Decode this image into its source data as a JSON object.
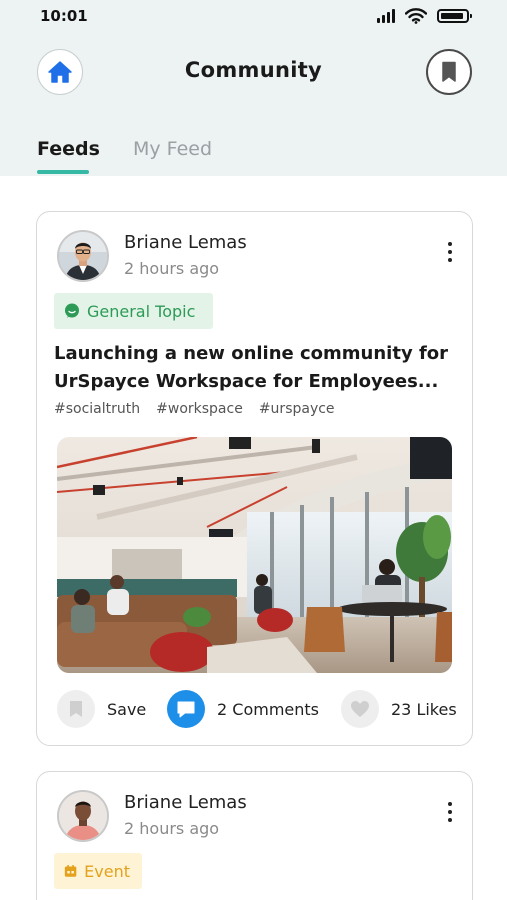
{
  "status_bar": {
    "time": "10:01"
  },
  "header": {
    "title": "Community",
    "home_icon": "home-icon",
    "bookmark_icon": "bookmark-icon"
  },
  "tabs": [
    {
      "label": "Feeds",
      "active": true
    },
    {
      "label": "My Feed",
      "active": false
    }
  ],
  "posts": [
    {
      "author": "Briane Lemas",
      "posted": "2 hours ago",
      "tag": {
        "label": "General Topic",
        "icon": "chat-bubble-icon",
        "color": "#2d9b57"
      },
      "title": "Launching a new online community for UrSpayce Workspace for Employees...",
      "hashtags": [
        "#socialtruth",
        "#workspace",
        "#urspayce"
      ],
      "image": "office-coworking-photo",
      "actions": {
        "save": "Save",
        "comments": "2 Comments",
        "likes": "23 Likes"
      }
    },
    {
      "author": "Briane Lemas",
      "posted": "2 hours ago",
      "tag": {
        "label": "Event",
        "icon": "calendar-icon",
        "color": "#e3a21c"
      }
    }
  ],
  "colors": {
    "accent": "#35b8a4",
    "comment_blue": "#1e8fe8",
    "home_blue": "#1e6fe8",
    "header_bg": "#edf2f2"
  }
}
